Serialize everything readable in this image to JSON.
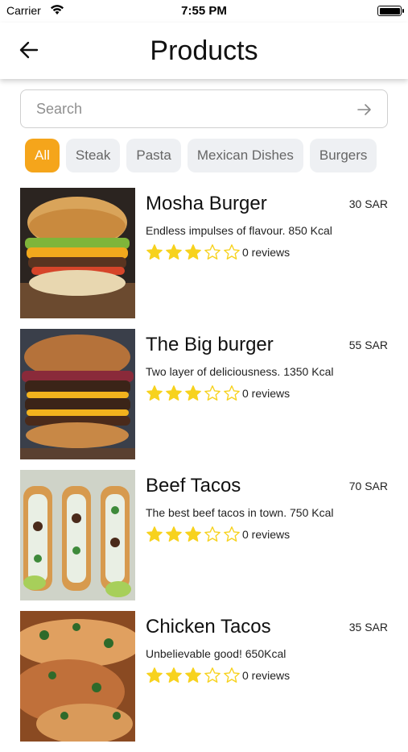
{
  "status": {
    "carrier": "Carrier",
    "time": "7:55 PM"
  },
  "header": {
    "title": "Products"
  },
  "search": {
    "placeholder": "Search"
  },
  "filters": [
    {
      "label": "All",
      "active": true
    },
    {
      "label": "Steak",
      "active": false
    },
    {
      "label": "Pasta",
      "active": false
    },
    {
      "label": "Mexican Dishes",
      "active": false
    },
    {
      "label": "Burgers",
      "active": false
    }
  ],
  "products": [
    {
      "name": "Mosha Burger",
      "price": "30 SAR",
      "description": "Endless impulses of flavour. 850 Kcal",
      "rating": 3,
      "reviews": "0 reviews",
      "image": "burger"
    },
    {
      "name": "The Big burger",
      "price": "55 SAR",
      "description": "Two layer of deliciousness. 1350 Kcal",
      "rating": 3,
      "reviews": "0 reviews",
      "image": "double-burger"
    },
    {
      "name": "Beef Tacos",
      "price": "70 SAR",
      "description": "The best beef tacos in town. 750 Kcal",
      "rating": 3,
      "reviews": "0 reviews",
      "image": "beef-tacos"
    },
    {
      "name": "Chicken Tacos",
      "price": "35 SAR",
      "description": "Unbelievable good! 650Kcal",
      "rating": 3,
      "reviews": "0 reviews",
      "image": "chicken-tacos"
    }
  ],
  "colors": {
    "accent": "#f5a51b",
    "star": "#f7d21e",
    "chip_bg": "#eef0f3"
  }
}
